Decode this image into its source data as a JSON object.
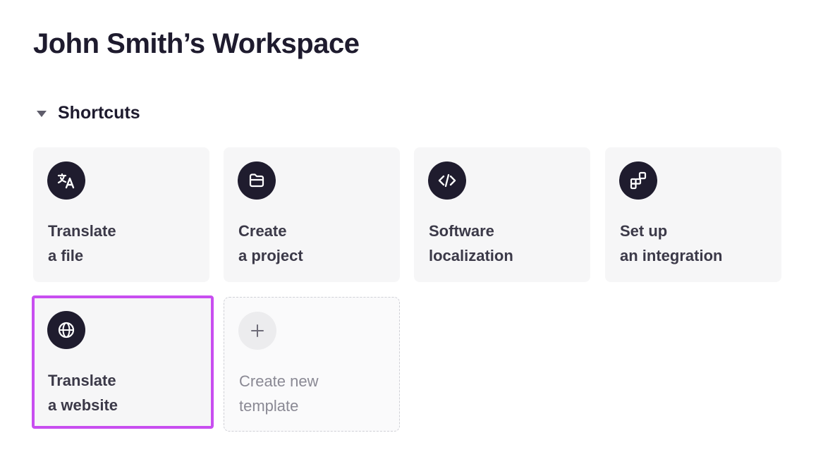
{
  "workspace": {
    "title": "John Smith’s Workspace"
  },
  "shortcuts": {
    "section_label": "Shortcuts",
    "items": [
      {
        "line1": "Translate",
        "line2": "a file",
        "icon": "translate-icon"
      },
      {
        "line1": "Create",
        "line2": "a project",
        "icon": "folder-icon"
      },
      {
        "line1": "Software",
        "line2": "localization",
        "icon": "code-icon"
      },
      {
        "line1": "Set up",
        "line2": "an integration",
        "icon": "integration-icon"
      },
      {
        "line1": "Translate",
        "line2": "a website",
        "icon": "globe-icon"
      },
      {
        "line1": "Create new",
        "line2": "template",
        "icon": "plus-icon"
      }
    ]
  },
  "colors": {
    "selected_outline": "#c84ef0",
    "icon_background": "#1f1c2e",
    "card_background": "#f6f6f7"
  }
}
